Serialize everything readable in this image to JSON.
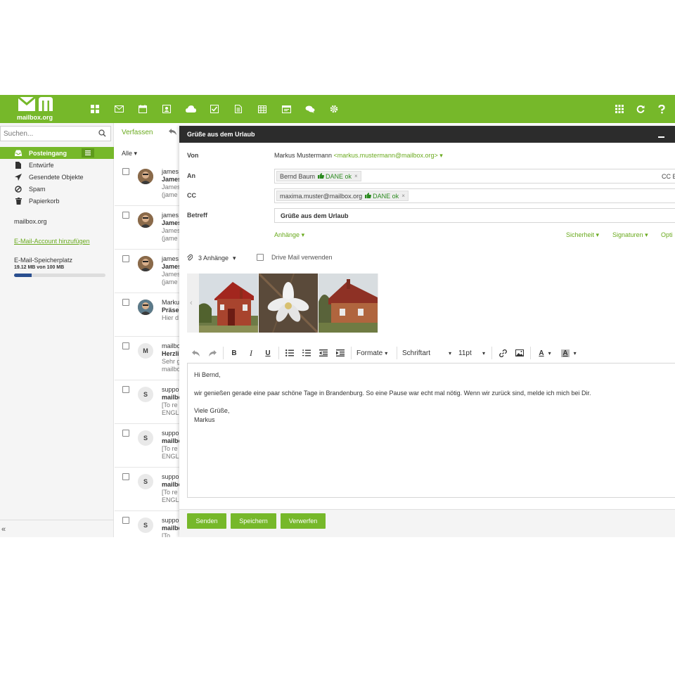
{
  "brand": {
    "logo_text": "mailbox.org",
    "accent": "#76b82a"
  },
  "topnav": [
    "apps-icon",
    "mail-icon",
    "calendar-icon",
    "contacts-icon",
    "cloud-icon",
    "tasks-icon",
    "document-icon",
    "spreadsheet-icon",
    "presentation-icon",
    "chat-icon",
    "settings-icon"
  ],
  "topright": [
    "grid-icon",
    "refresh-icon",
    "help-icon"
  ],
  "sidebar": {
    "search_placeholder": "Suchen...",
    "folders": [
      {
        "label": "Posteingang",
        "icon": "inbox-icon",
        "active": true
      },
      {
        "label": "Entwürfe",
        "icon": "draft-icon"
      },
      {
        "label": "Gesendete Objekte",
        "icon": "sent-icon"
      },
      {
        "label": "Spam",
        "icon": "spam-icon"
      },
      {
        "label": "Papierkorb",
        "icon": "trash-icon"
      }
    ],
    "account": "mailbox.org",
    "add_account": "E-Mail-Account hinzufügen",
    "storage_label": "E-Mail-Speicherplatz",
    "storage_value": "19.12 MB von 100 MB",
    "storage_fraction": 0.19,
    "collapse": "«"
  },
  "list": {
    "compose": "Verfassen",
    "filter": "Alle",
    "rows": [
      {
        "avatar": "photo",
        "l1": "james",
        "l2": "James",
        "l3": "James",
        "l4": "(jame"
      },
      {
        "avatar": "photo",
        "l1": "james",
        "l2": "James",
        "l3": "James",
        "l4": "(jame"
      },
      {
        "avatar": "photo",
        "l1": "james",
        "l2": "James",
        "l3": "James",
        "l4": "(jame"
      },
      {
        "avatar": "photo2",
        "l1": "Marku",
        "l2": "Präse",
        "l3": "Hier d",
        "l4": ""
      },
      {
        "avatar": "M",
        "l1": "mailbo",
        "l2": "Herzli",
        "l3": "Sehr g",
        "l4": "mailbo"
      },
      {
        "avatar": "S",
        "l1": "suppo",
        "l2": "mailbo",
        "l3": "[To re",
        "l4": "ENGL"
      },
      {
        "avatar": "S",
        "l1": "suppo",
        "l2": "mailbo",
        "l3": "[To re",
        "l4": "ENGL"
      },
      {
        "avatar": "S",
        "l1": "suppo",
        "l2": "mailbo",
        "l3": "[To re",
        "l4": "ENGL"
      },
      {
        "avatar": "S",
        "l1": "suppo",
        "l2": "mailbo",
        "l3": "[To",
        "l4": ""
      }
    ]
  },
  "compose": {
    "title": "Grüße aus dem Urlaub",
    "from_label": "Von",
    "from_name": "Markus Mustermann",
    "from_email": "<markus.mustermann@mailbox.org>",
    "to_label": "An",
    "to_token": "Bernd Baum",
    "dane": "DANE ok",
    "cc_bcc": "CC  BC",
    "cc_label": "CC",
    "cc_token": "maxima.muster@mailbox.org",
    "subject_label": "Betreff",
    "subject": "Grüße aus dem Urlaub",
    "attachments_link": "Anhänge",
    "security": "Sicherheit",
    "signatures": "Signaturen",
    "options": "Opti",
    "attach_count": "3 Anhänge",
    "drive_mail": "Drive Mail verwenden",
    "toolbar": {
      "formats": "Formate",
      "font": "Schriftart",
      "size": "11pt"
    },
    "body": {
      "greeting": "Hi Bernd,",
      "text": "wir genießen gerade eine paar schöne Tage in Brandenburg. So eine Pause war echt mal nötig. Wenn wir zurück sind, melde ich mich bei Dir.",
      "closing": "Viele Grüße,",
      "name": "Markus"
    },
    "send": "Senden",
    "save": "Speichern",
    "discard": "Verwerfen"
  }
}
